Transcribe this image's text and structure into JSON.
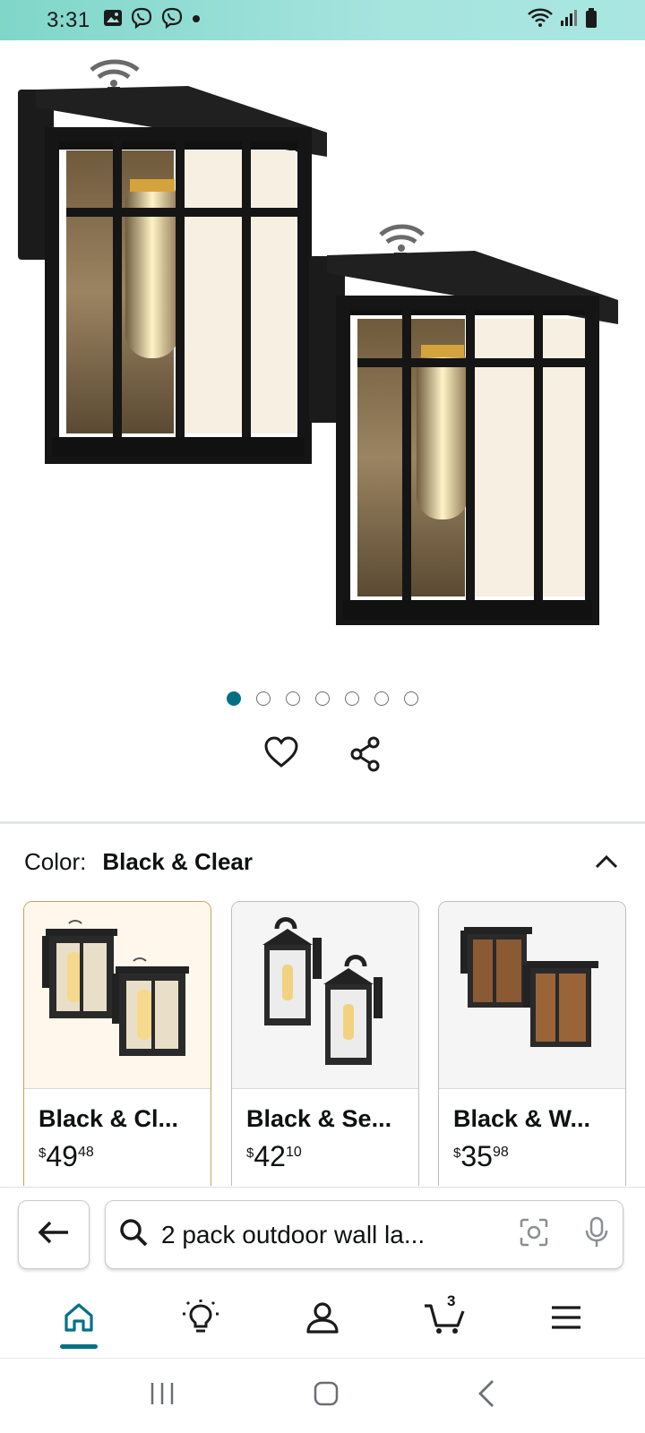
{
  "status_bar": {
    "time": "3:31",
    "icons": [
      "gallery-icon",
      "viber-icon",
      "viber-icon",
      "notification-dot-icon",
      "wifi-icon",
      "signal-icon",
      "battery-icon"
    ]
  },
  "gallery": {
    "image_count": 7,
    "active_index": 0
  },
  "actions": {
    "wishlist": "heart-icon",
    "share": "share-icon"
  },
  "color_selector": {
    "label": "Color:",
    "selected": "Black & Clear",
    "options": [
      {
        "name": "Black & Cl...",
        "currency": "$",
        "whole": "49",
        "fraction": "48"
      },
      {
        "name": "Black & Se...",
        "currency": "$",
        "whole": "42",
        "fraction": "10"
      },
      {
        "name": "Black & W...",
        "currency": "$",
        "whole": "35",
        "fraction": "98"
      }
    ]
  },
  "search": {
    "query": "2 pack outdoor wall la..."
  },
  "bottom_nav": {
    "items": [
      "home-icon",
      "inspire-icon",
      "account-icon",
      "cart-icon",
      "menu-icon"
    ],
    "cart_count": "3",
    "active": "home"
  },
  "colors": {
    "accent": "#007185",
    "selected_border": "#c8a45a",
    "status_bar": "#8fdcd2"
  }
}
